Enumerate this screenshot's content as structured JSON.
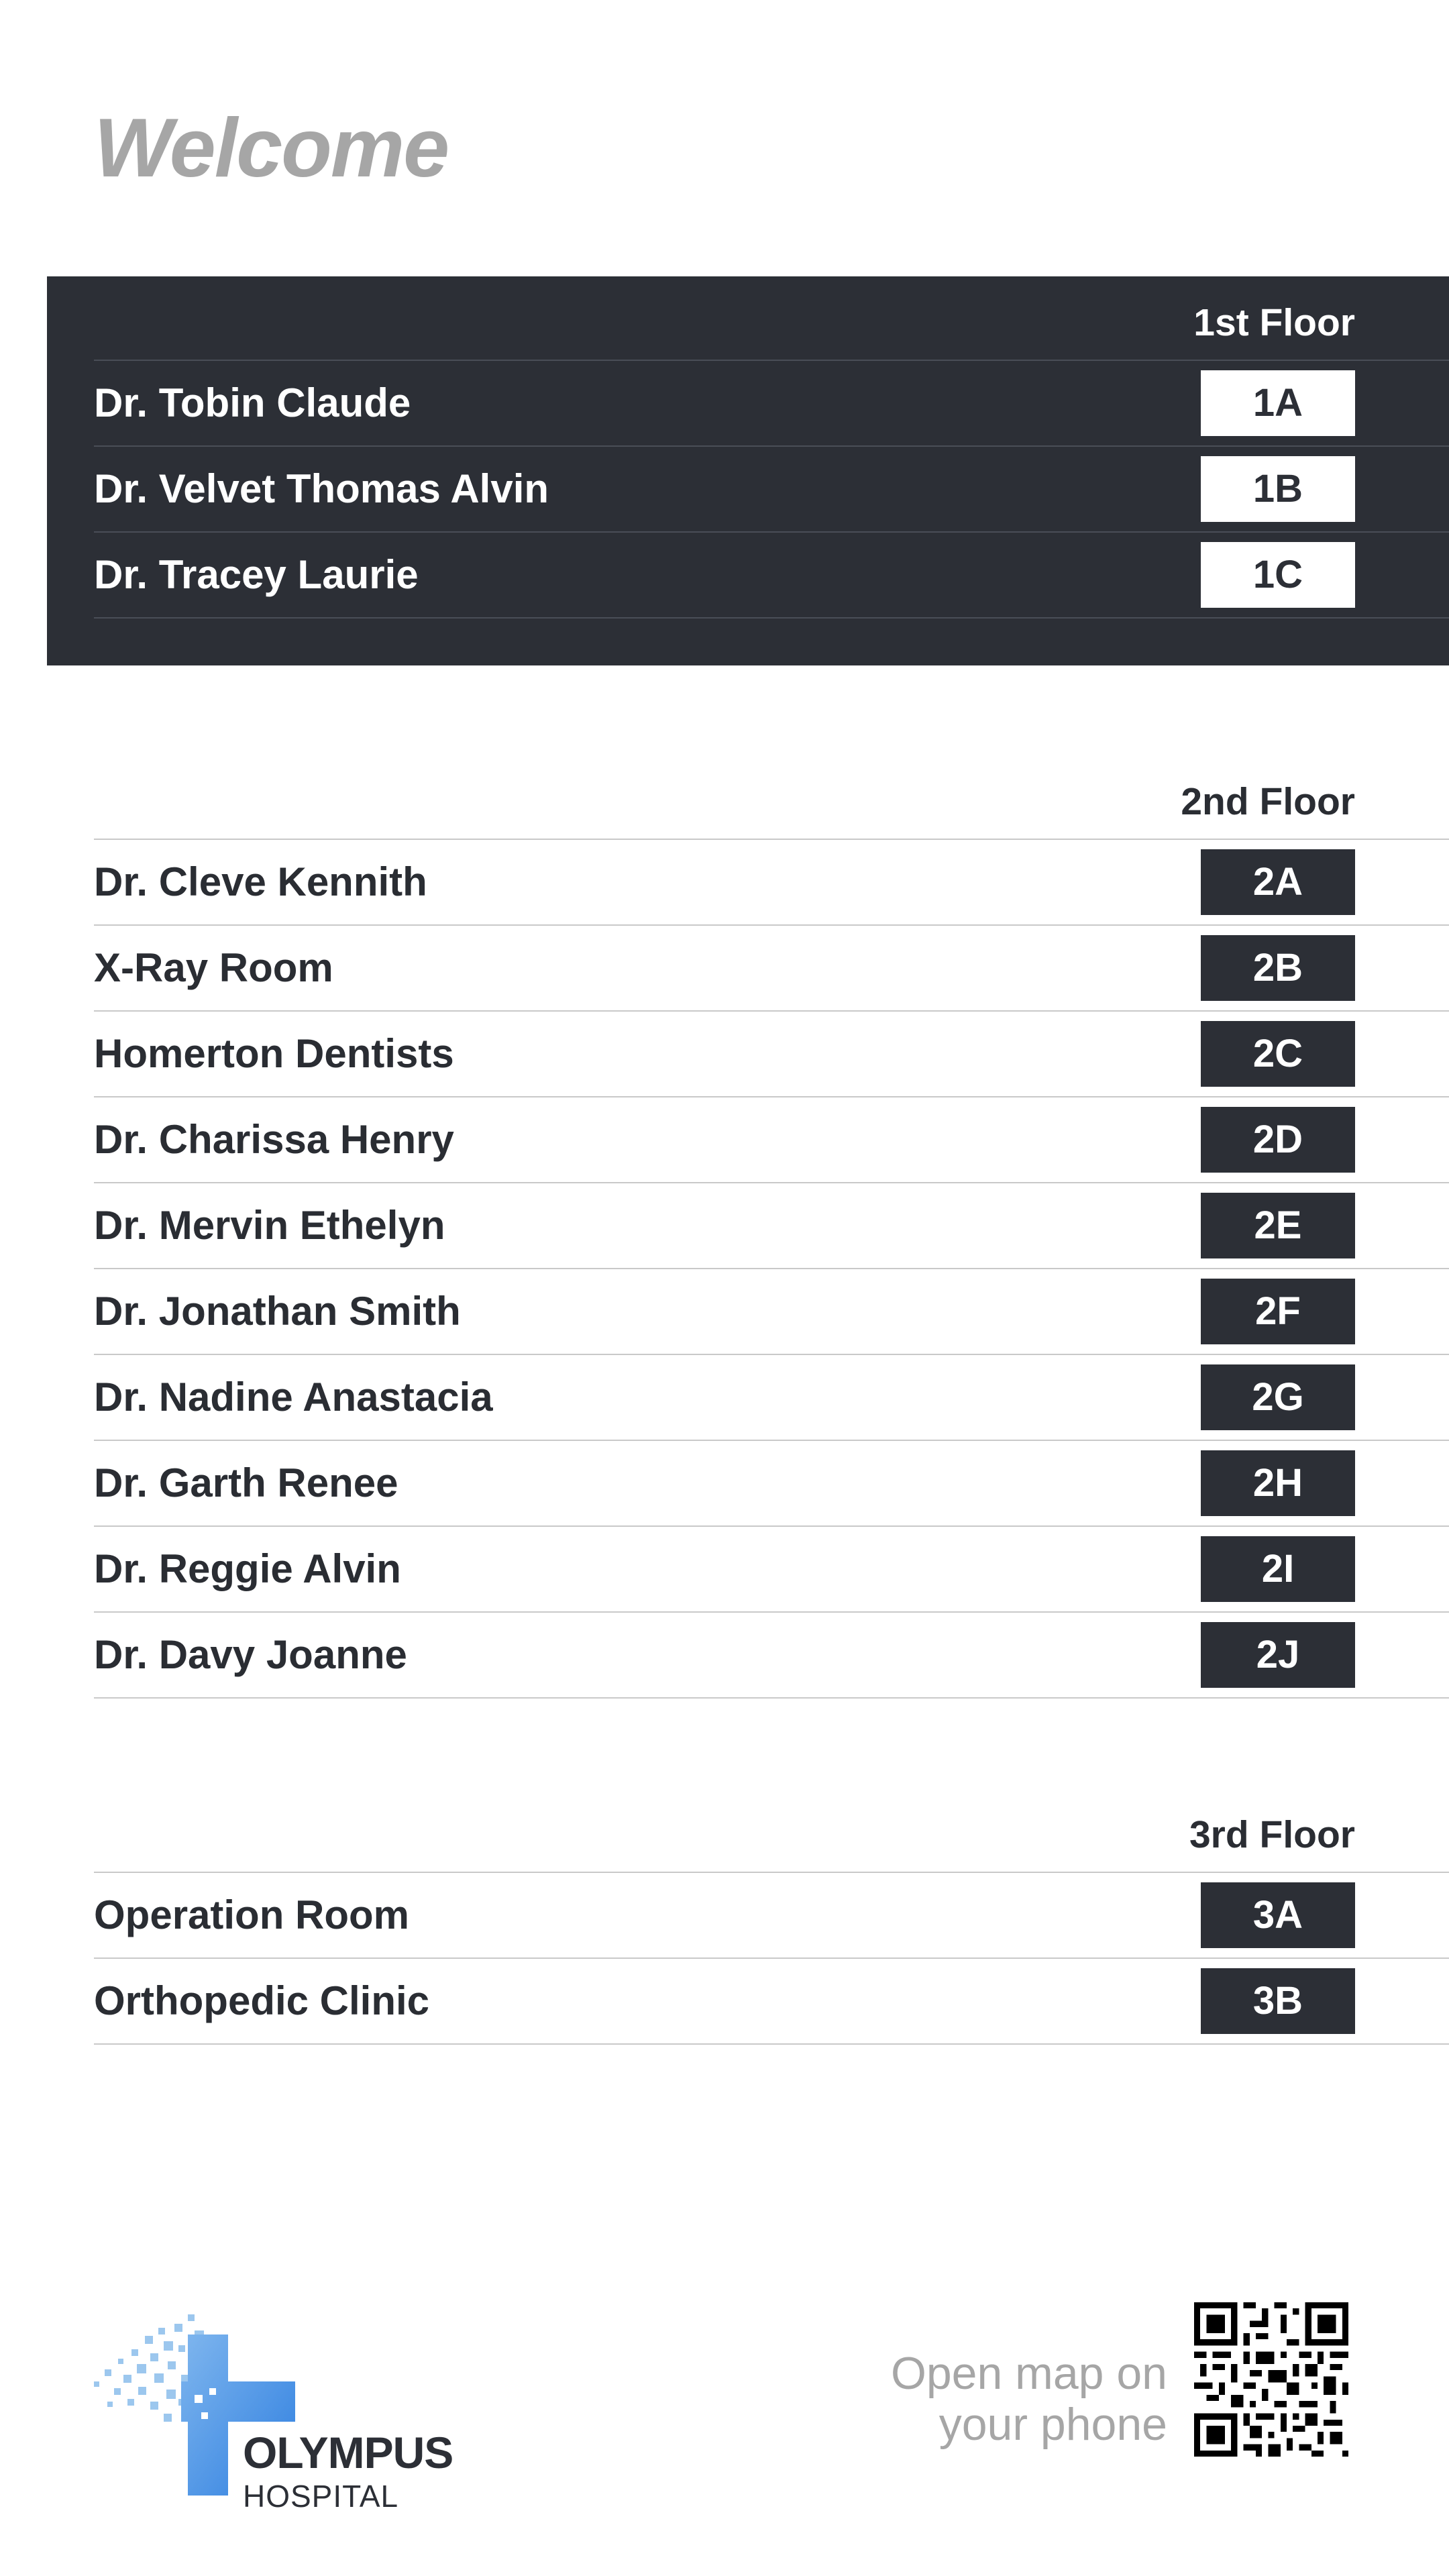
{
  "header": {
    "welcome": "Welcome"
  },
  "floors": [
    {
      "title": "1st Floor",
      "rooms": [
        {
          "name": "Dr. Tobin Claude",
          "room": "1A"
        },
        {
          "name": "Dr. Velvet Thomas Alvin",
          "room": "1B"
        },
        {
          "name": "Dr. Tracey Laurie",
          "room": "1C"
        }
      ]
    },
    {
      "title": "2nd Floor",
      "rooms": [
        {
          "name": "Dr. Cleve Kennith",
          "room": "2A"
        },
        {
          "name": "X-Ray Room",
          "room": "2B"
        },
        {
          "name": "Homerton Dentists",
          "room": "2C"
        },
        {
          "name": "Dr. Charissa Henry",
          "room": "2D"
        },
        {
          "name": "Dr. Mervin Ethelyn",
          "room": "2E"
        },
        {
          "name": "Dr. Jonathan Smith",
          "room": "2F"
        },
        {
          "name": "Dr. Nadine Anastacia",
          "room": "2G"
        },
        {
          "name": "Dr. Garth Renee",
          "room": "2H"
        },
        {
          "name": "Dr. Reggie Alvin",
          "room": "2I"
        },
        {
          "name": "Dr. Davy Joanne",
          "room": "2J"
        }
      ]
    },
    {
      "title": "3rd Floor",
      "rooms": [
        {
          "name": "Operation Room",
          "room": "3A"
        },
        {
          "name": "Orthopedic Clinic",
          "room": "3B"
        }
      ]
    }
  ],
  "footer": {
    "brand_name": "OLYMPUS",
    "brand_sub": "HOSPITAL",
    "map_line1": "Open map on",
    "map_line2": "your phone",
    "qr_icon": "qr-code-icon"
  },
  "colors": {
    "dark": "#2c2f36",
    "muted": "#a6a6a6",
    "logo_blue": "#4a90e2",
    "logo_light_blue": "#9cc7ee"
  }
}
